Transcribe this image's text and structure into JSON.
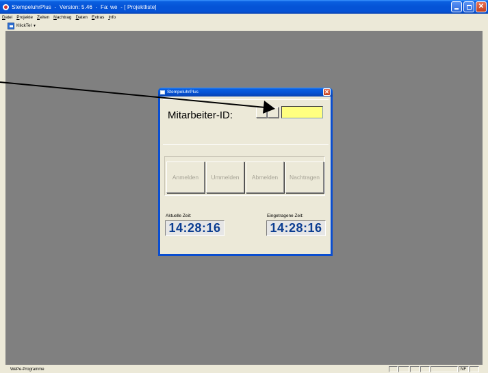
{
  "window": {
    "title": "StempeluhrPlus  -  Version: 5.46  -  Fa: we  - [ Projektliste]"
  },
  "menu": {
    "items": [
      {
        "first": "D",
        "rest": "atei"
      },
      {
        "first": "P",
        "rest": "rojekte"
      },
      {
        "first": "Z",
        "rest": "eiten"
      },
      {
        "first": "N",
        "rest": "achtrag"
      },
      {
        "first": "D",
        "rest": "aten"
      },
      {
        "first": "E",
        "rest": "xtras"
      },
      {
        "first": "I",
        "rest": "nfo"
      }
    ]
  },
  "toolbar": {
    "dropdown_label": "KlickTel"
  },
  "dialog": {
    "title": "StempeluhrPlus",
    "id_label": "Mitarbeiter-ID:",
    "buttons": {
      "anmelden": "Anmelden",
      "ummelden": "Ummelden",
      "abmelden": "Abmelden",
      "nachtragen": "Nachtragen"
    },
    "current_time_label": "Aktuelle Zeit:",
    "current_time_value": "14:28:16",
    "entered_time_label": "Eingetragene Zeit:",
    "entered_time_value": "14:28:16"
  },
  "statusbar": {
    "text": "WePe-Programme",
    "panel_nf": "NF"
  },
  "colors": {
    "titlebar": "#0553d6",
    "mdi_background": "#808080",
    "input_background": "#ffff80",
    "time_text": "#0b3d91",
    "disabled_text": "#a6a396"
  }
}
